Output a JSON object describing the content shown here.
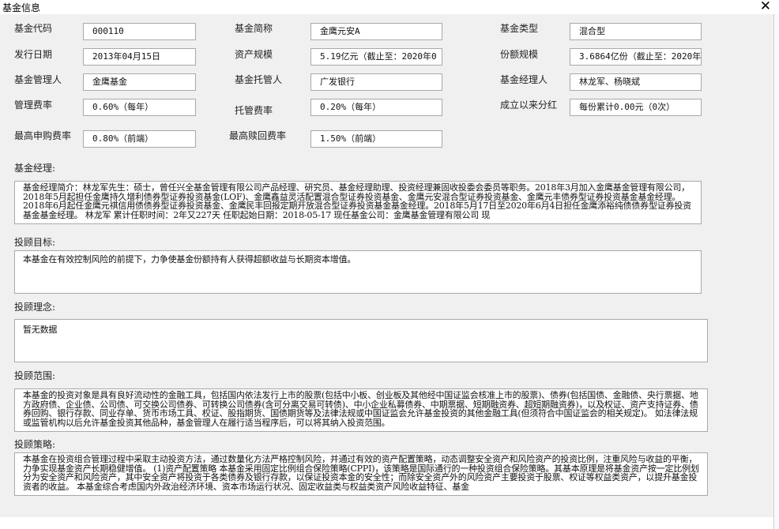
{
  "window": {
    "title": "基金信息"
  },
  "fields": {
    "code": {
      "label": "基金代码",
      "value": "000110"
    },
    "short": {
      "label": "基金简称",
      "value": "金鹰元安A"
    },
    "type": {
      "label": "基金类型",
      "value": "混合型"
    },
    "issue": {
      "label": "发行日期",
      "value": "2013年04月15日"
    },
    "assets": {
      "label": "资产规模",
      "value": "5.19亿元（截止至：2020年0"
    },
    "shares": {
      "label": "份额规模",
      "value": "3.6864亿份（截止至：2020年"
    },
    "manager": {
      "label": "基金管理人",
      "value": "金鹰基金"
    },
    "custodian": {
      "label": "基金托管人",
      "value": "广发银行"
    },
    "fm": {
      "label": "基金经理人",
      "value": "林龙军、杨晓斌"
    },
    "mgmtfee": {
      "label": "管理费率",
      "value": "0.60%（每年）"
    },
    "custfee": {
      "label": "托管费率",
      "value": "0.20%（每年）"
    },
    "dividend": {
      "label": "成立以来分红",
      "value": "每份累计0.00元（0次）"
    },
    "buyfee": {
      "label": "最高申购费率",
      "value": "0.80%（前端）"
    },
    "redeemfee": {
      "label": "最高赎回费率",
      "value": "1.50%（前端）"
    }
  },
  "sections": {
    "manager_intro": {
      "label": "基金经理:",
      "text": "基金经理简介：林龙军先生：硕士，曾任兴全基金管理有限公司产品经理、研究员、基金经理助理、投资经理兼固收投委会委员等职务。2018年3月加入金鹰基金管理有限公司，2018年5月起担任金鹰持久增利债券型证券投资基金(LOF)、金鹰鑫益灵活配置混合型证券投资基金、金鹰元安混合型证券投资基金、金鹰元丰债券型证券投资基金基金经理。2018年6月起任金鹰元祺信用债债券型证券投资基金、金鹰民丰回报定期开放混合型证券投资基金基金经理。2018年5月17日至2020年6月4日担任金鹰添裕纯债债券型证券投资基金基金经理。 林龙军 累计任职时间：2年又227天 任职起始日期：2018-05-17 现任基金公司：金鹰基金管理有限公司 现"
    },
    "objective": {
      "label": "投顾目标:",
      "text": "本基金在有效控制风险的前提下，力争使基金份额持有人获得超额收益与长期资本增值。"
    },
    "philosophy": {
      "label": "投顾理念:",
      "text": "暂无数据"
    },
    "scope": {
      "label": "投顾范围:",
      "text": "本基金的投资对象是具有良好流动性的金融工具，包括国内依法发行上市的股票(包括中小板、创业板及其他经中国证监会核准上市的股票)、债券(包括国债、金融债、央行票据、地方政府债、企业债、公司债、可交换公司债券、可转换公司债券(含可分离交易可转债)、中小企业私募债券、中期票据、短期融资券、超短期融资券)，以及权证、资产支持证券、债券回购、银行存款、同业存单、货币市场工具、权证、股指期货、国债期货等及法律法规或中国证监会允许基金投资的其他金融工具(但须符合中国证监会的相关规定)。 如法律法规或监管机构以后允许基金投资其他品种，基金管理人在履行适当程序后，可以将其纳入投资范围。"
    },
    "strategy": {
      "label": "投顾策略:",
      "text": "本基金在投资组合管理过程中采取主动投资方法，通过数量化方法严格控制风险，并通过有效的资产配置策略，动态调整安全资产和风险资产的投资比例，注重风险与收益的平衡，力争实现基金资产长期稳健增值。 (1)资产配置策略 本基金采用固定比例组合保险策略(CPPI)，该策略是国际通行的一种投资组合保险策略。其基本原理是将基金资产按一定比例划分为安全资产和风险资产，其中安全资产将投资于各类债券及银行存款，以保证投资本金的安全性；而除安全资产外的风险资产主要投资于股票、权证等权益类资产，以提升基金投资者的收益。 本基金综合考虑国内外政治经济环境、资本市场运行状况、固定收益类与权益类资产风险收益特征、基金"
    }
  }
}
